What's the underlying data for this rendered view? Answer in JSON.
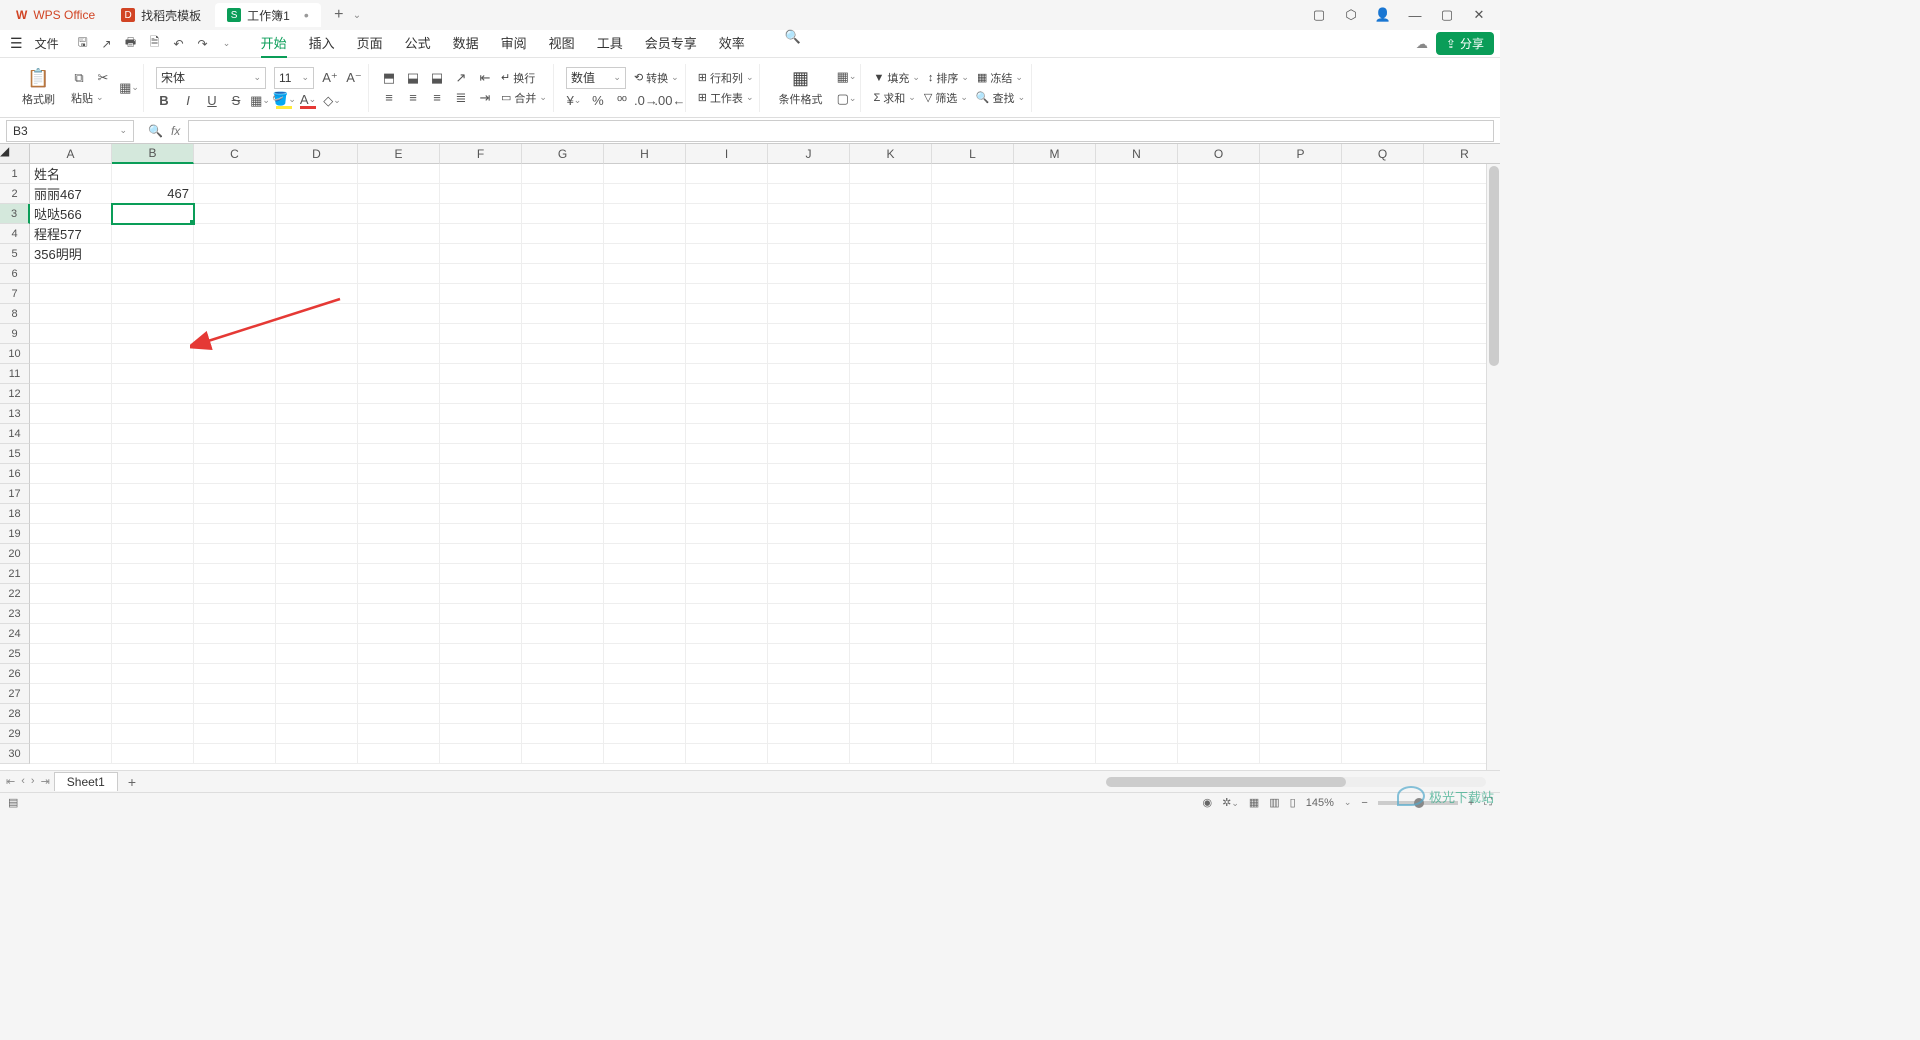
{
  "titlebar": {
    "app_name": "WPS Office",
    "tabs": [
      {
        "icon": "D",
        "label": "找稻壳模板",
        "bg": "#d14424"
      },
      {
        "icon": "S",
        "label": "工作簿1",
        "bg": "#0a9d58",
        "active": true
      }
    ],
    "add": "+"
  },
  "menubar": {
    "file": "文件",
    "tabs": [
      "开始",
      "插入",
      "页面",
      "公式",
      "数据",
      "审阅",
      "视图",
      "工具",
      "会员专享",
      "效率"
    ],
    "active_tab": "开始",
    "share": "分享"
  },
  "ribbon": {
    "format_brush": "格式刷",
    "paste": "粘贴",
    "font_name": "宋体",
    "font_size": "11",
    "bold": "B",
    "italic": "I",
    "underline": "U",
    "strike": "S",
    "wrap": "换行",
    "number_format": "数值",
    "convert": "转换",
    "row_col": "行和列",
    "worksheet": "工作表",
    "cond_format": "条件格式",
    "merge_all": "合并",
    "fill": "填充",
    "sort": "排序",
    "freeze": "冻结",
    "sum": "求和",
    "filter": "筛选",
    "find": "查找"
  },
  "name_box": "B3",
  "columns": [
    "A",
    "B",
    "C",
    "D",
    "E",
    "F",
    "G",
    "H",
    "I",
    "J",
    "K",
    "L",
    "M",
    "N",
    "O",
    "P",
    "Q",
    "R"
  ],
  "selected_col": "B",
  "row_count": 30,
  "selected_row": 3,
  "cells": {
    "A1": "姓名",
    "A2": "丽丽467",
    "A3": "哒哒566",
    "A4": "程程577",
    "A5": "356明明",
    "B2": "467"
  },
  "active_cell": "B3",
  "sheet": {
    "name": "Sheet1",
    "add": "+"
  },
  "status": {
    "zoom": "145%"
  },
  "watermark": "极光下载站"
}
